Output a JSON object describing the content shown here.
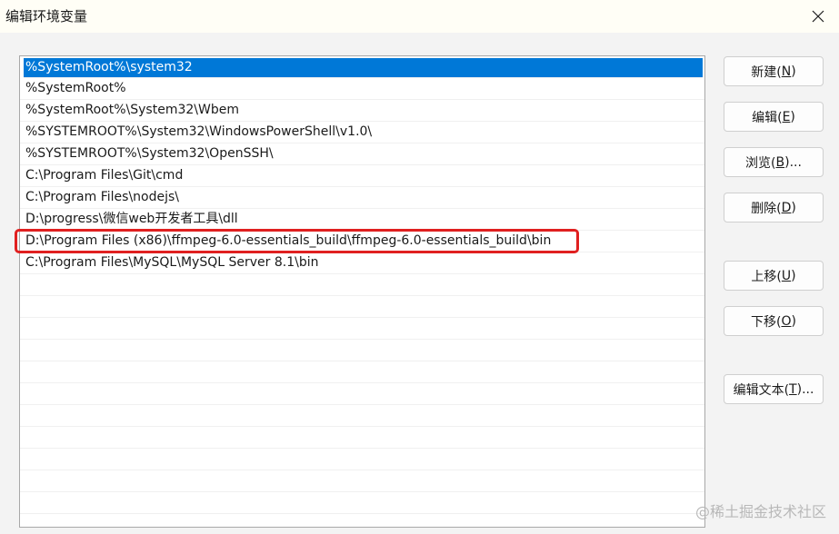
{
  "window": {
    "title": "编辑环境变量",
    "close_icon": "close-icon"
  },
  "path_list": {
    "items": [
      "%SystemRoot%\\system32",
      "%SystemRoot%",
      "%SystemRoot%\\System32\\Wbem",
      "%SYSTEMROOT%\\System32\\WindowsPowerShell\\v1.0\\",
      "%SYSTEMROOT%\\System32\\OpenSSH\\",
      "C:\\Program Files\\Git\\cmd",
      "C:\\Program Files\\nodejs\\",
      "D:\\progress\\微信web开发者工具\\dll",
      "D:\\Program Files (x86)\\ffmpeg-6.0-essentials_build\\ffmpeg-6.0-essentials_build\\bin",
      "C:\\Program Files\\MySQL\\MySQL Server 8.1\\bin"
    ],
    "selected_index": 0,
    "highlighted_index": 8,
    "selection_color": "#0078d7",
    "highlight_color": "#e02020"
  },
  "buttons": {
    "new": {
      "label": "新建(",
      "key": "N",
      "suffix": ")"
    },
    "edit": {
      "label": "编辑(",
      "key": "E",
      "suffix": ")"
    },
    "browse": {
      "label": "浏览(",
      "key": "B",
      "suffix": ")..."
    },
    "delete": {
      "label": "删除(",
      "key": "D",
      "suffix": ")"
    },
    "move_up": {
      "label": "上移(",
      "key": "U",
      "suffix": ")"
    },
    "move_down": {
      "label": "下移(",
      "key": "O",
      "suffix": ")"
    },
    "edit_text": {
      "label": "编辑文本(",
      "key": "T",
      "suffix": ")..."
    }
  },
  "watermark": "@稀土掘金技术社区"
}
